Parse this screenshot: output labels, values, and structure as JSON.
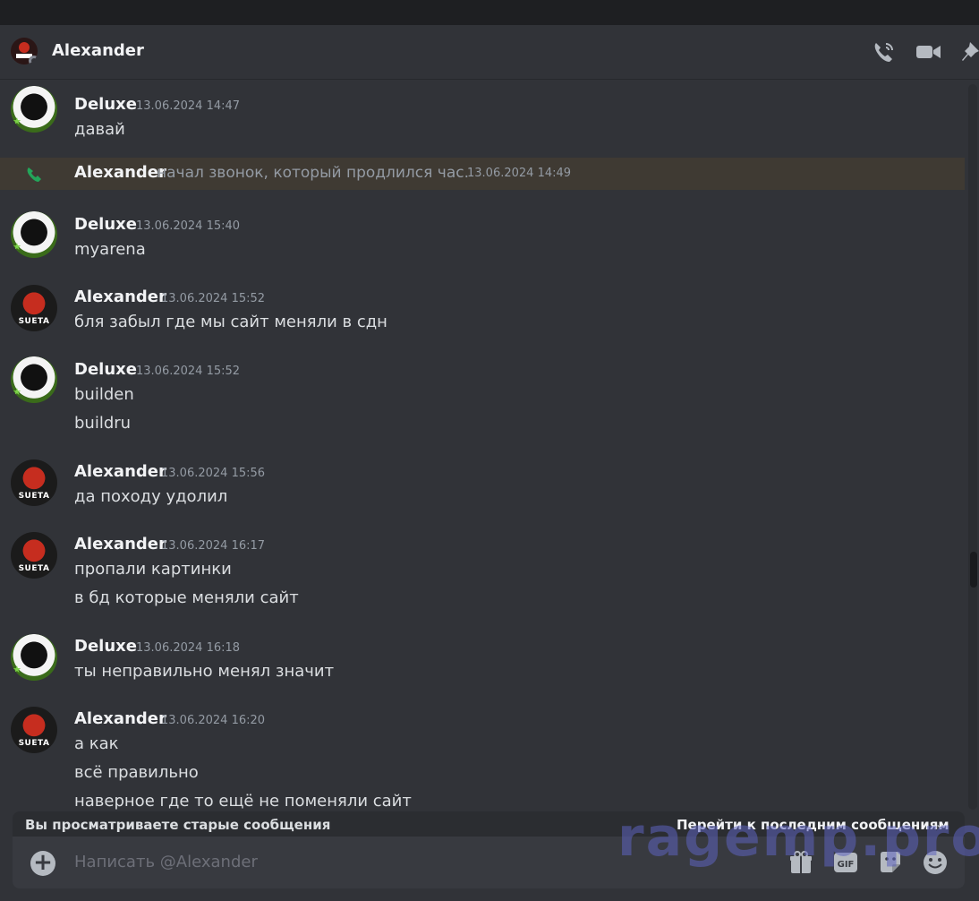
{
  "header": {
    "title": "Alexander"
  },
  "call": {
    "name": "Alexander",
    "text": "начал звонок, который продлился час.",
    "time": "13.06.2024 14:49"
  },
  "messages": [
    {
      "name": "Deluxe",
      "time": "13.06.2024 14:47",
      "lines": [
        "давай"
      ]
    },
    {
      "name": "Deluxe",
      "time": "13.06.2024 15:40",
      "lines": [
        "myarena"
      ]
    },
    {
      "name": "Alexander",
      "time": "13.06.2024 15:52",
      "lines": [
        "бля забыл где мы сайт меняли в сдн"
      ]
    },
    {
      "name": "Deluxe",
      "time": "13.06.2024 15:52",
      "lines": [
        "builden",
        "buildru"
      ]
    },
    {
      "name": "Alexander",
      "time": "13.06.2024 15:56",
      "lines": [
        "да походу удолил"
      ]
    },
    {
      "name": "Alexander",
      "time": "13.06.2024 16:17",
      "lines": [
        "пропали картинки",
        "в бд которые меняли сайт"
      ]
    },
    {
      "name": "Deluxe",
      "time": "13.06.2024 16:18",
      "lines": [
        "ты неправильно менял значит"
      ]
    },
    {
      "name": "Alexander",
      "time": "13.06.2024 16:20",
      "lines": [
        "а как",
        "всё правильно",
        "наверное где то ещё не поменяли сайт"
      ]
    }
  ],
  "avatar_badge": "SUETA",
  "old_messages": {
    "notice": "Вы просматриваете старые сообщения",
    "jump": "Перейти к последним сообщениям"
  },
  "composer": {
    "placeholder": "Написать @Alexander",
    "gif_label": "GIF"
  },
  "watermark": "ragemp.pro"
}
